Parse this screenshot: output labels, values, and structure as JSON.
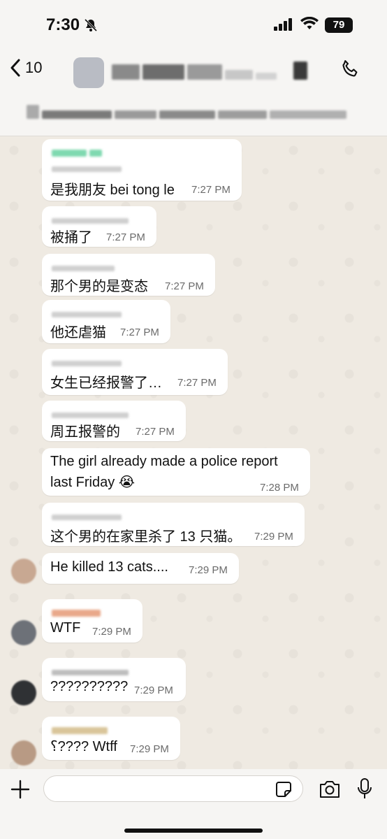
{
  "status_bar": {
    "time": "7:30",
    "battery": "79"
  },
  "header": {
    "back_count": "10"
  },
  "messages": [
    {
      "text": "是我朋友 bei tong le",
      "time": "7:27 PM"
    },
    {
      "text": "被捅了",
      "time": "7:27 PM"
    },
    {
      "text": "那个男的是变态",
      "time": "7:27 PM"
    },
    {
      "text": "他还虐猫",
      "time": "7:27 PM"
    },
    {
      "text": "女生已经报警了…",
      "time": "7:27 PM"
    },
    {
      "text": "周五报警的",
      "time": "7:27 PM"
    },
    {
      "text": "The girl already made a police report",
      "text2": "last Friday 😭",
      "time": "7:28 PM"
    },
    {
      "text": "这个男的在家里杀了 13 只猫。",
      "time": "7:29 PM"
    },
    {
      "text": "He killed 13 cats....",
      "time": "7:29 PM"
    },
    {
      "text": "WTF",
      "time": "7:29 PM"
    },
    {
      "text": "??????????",
      "time": "7:29 PM"
    },
    {
      "text": "⸮???? Wtff",
      "time": "7:29 PM"
    }
  ],
  "icons": {
    "back": "chevron-left-icon",
    "call": "phone-icon",
    "mute": "bell-slash-icon",
    "plus": "plus-icon",
    "sticker": "sticker-icon",
    "camera": "camera-icon",
    "mic": "microphone-icon"
  },
  "colors": {
    "chat_bg": "#efeae2",
    "bubble": "#ffffff",
    "sender_green": "#3fbf8a",
    "sender_orange": "#e39a7a"
  }
}
